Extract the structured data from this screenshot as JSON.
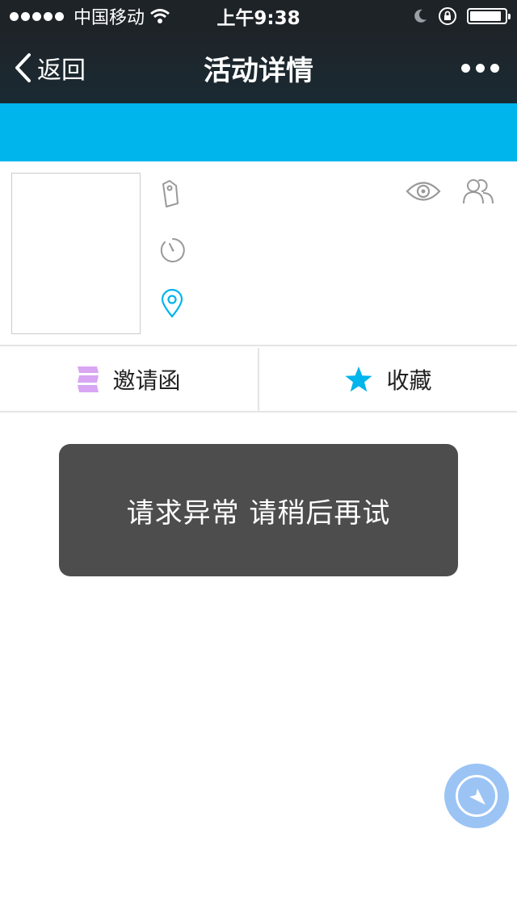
{
  "status_bar": {
    "carrier": "中国移动",
    "time": "上午9:38",
    "battery_level": 0.9
  },
  "nav": {
    "back_label": "返回",
    "title": "活动详情"
  },
  "colors": {
    "nav_bg": "#1e2328",
    "banner": "#00b4ec",
    "accent": "#00b4ec",
    "toast_bg": "#4d4d4d",
    "invite_icon": "#d8a6f3",
    "float_button": "#9bc4f5"
  },
  "info_icons": [
    "tag-icon",
    "timer-icon",
    "location-pin-icon",
    "eye-icon",
    "people-icon"
  ],
  "actions": {
    "invite_label": "邀请函",
    "favorite_label": "收藏"
  },
  "toast": {
    "message": "请求异常 请稍后再试"
  }
}
